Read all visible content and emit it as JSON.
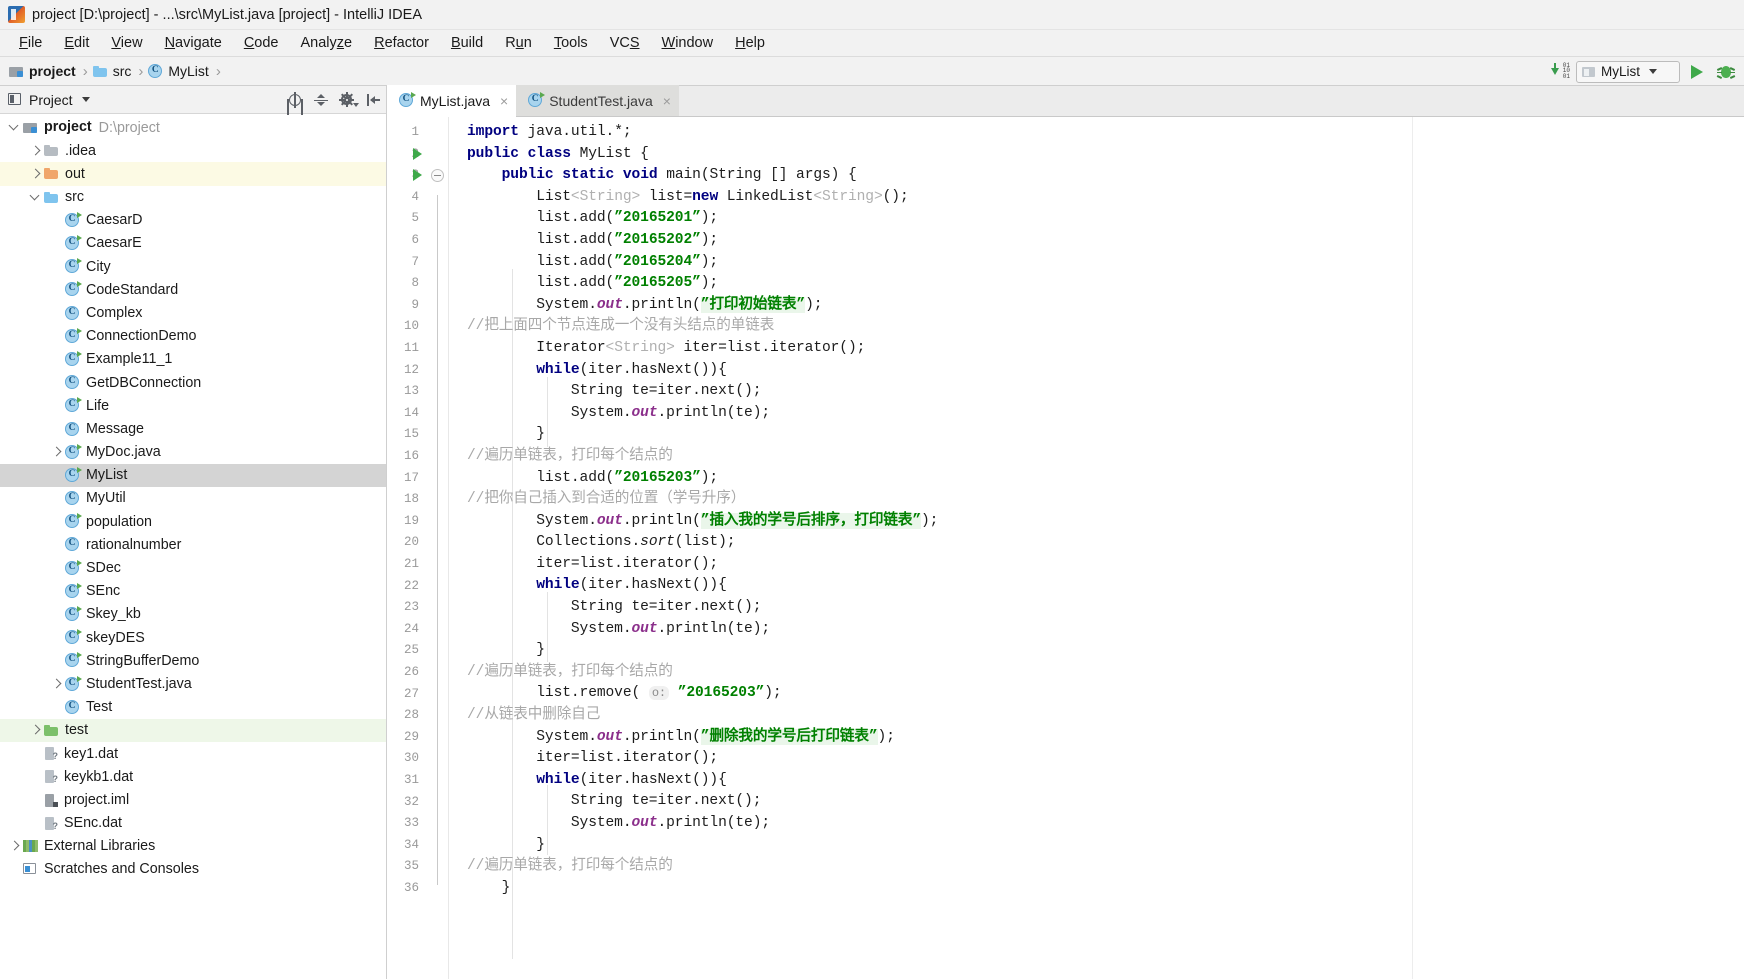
{
  "window": {
    "title": "project [D:\\project] - ...\\src\\MyList.java [project] - IntelliJ IDEA",
    "app_icon": "intellij-idea-icon"
  },
  "menubar": {
    "items": [
      {
        "label": "File"
      },
      {
        "label": "Edit"
      },
      {
        "label": "View"
      },
      {
        "label": "Navigate"
      },
      {
        "label": "Code"
      },
      {
        "label": "Analyze"
      },
      {
        "label": "Refactor"
      },
      {
        "label": "Build"
      },
      {
        "label": "Run"
      },
      {
        "label": "Tools"
      },
      {
        "label": "VCS"
      },
      {
        "label": "Window"
      },
      {
        "label": "Help"
      }
    ]
  },
  "navbar": {
    "crumbs": [
      {
        "label": "project",
        "icon": "module-icon",
        "bold": true
      },
      {
        "label": "src",
        "icon": "folder-icon",
        "bold": false
      },
      {
        "label": "MyList",
        "icon": "java-class-icon",
        "bold": false
      }
    ],
    "separator": "›",
    "updates_icon": "download-updates-icon",
    "run_config": {
      "name": "MyList",
      "icon": "run-config-icon"
    },
    "run_button": "run-icon",
    "debug_button": "debug-icon"
  },
  "panel": {
    "title": "Project",
    "icon": "project-view-icon",
    "tools": [
      {
        "name": "locate-icon"
      },
      {
        "name": "collapse-all-icon"
      },
      {
        "name": "settings-gear-icon"
      },
      {
        "name": "hide-panel-icon"
      }
    ],
    "tree": [
      {
        "label": "project",
        "sub": "D:\\project",
        "icon": "module-icon",
        "indent": 0,
        "arrow": "open",
        "bold": true,
        "hl": ""
      },
      {
        "label": ".idea",
        "sub": "",
        "icon": "folder-gray-icon",
        "indent": 1,
        "arrow": "closed",
        "bold": false,
        "hl": ""
      },
      {
        "label": "out",
        "sub": "",
        "icon": "folder-orange-icon",
        "indent": 1,
        "arrow": "closed",
        "bold": false,
        "hl": "yellow"
      },
      {
        "label": "src",
        "sub": "",
        "icon": "folder-blue-icon",
        "indent": 1,
        "arrow": "open",
        "bold": false,
        "hl": ""
      },
      {
        "label": "CaesarD",
        "sub": "",
        "icon": "java-class-runnable-icon",
        "indent": 2,
        "arrow": "none",
        "bold": false,
        "hl": ""
      },
      {
        "label": "CaesarE",
        "sub": "",
        "icon": "java-class-runnable-icon",
        "indent": 2,
        "arrow": "none",
        "bold": false,
        "hl": ""
      },
      {
        "label": "City",
        "sub": "",
        "icon": "java-class-runnable-icon",
        "indent": 2,
        "arrow": "none",
        "bold": false,
        "hl": ""
      },
      {
        "label": "CodeStandard",
        "sub": "",
        "icon": "java-class-runnable-icon",
        "indent": 2,
        "arrow": "none",
        "bold": false,
        "hl": ""
      },
      {
        "label": "Complex",
        "sub": "",
        "icon": "java-class-icon",
        "indent": 2,
        "arrow": "none",
        "bold": false,
        "hl": ""
      },
      {
        "label": "ConnectionDemo",
        "sub": "",
        "icon": "java-class-runnable-icon",
        "indent": 2,
        "arrow": "none",
        "bold": false,
        "hl": ""
      },
      {
        "label": "Example11_1",
        "sub": "",
        "icon": "java-class-runnable-icon",
        "indent": 2,
        "arrow": "none",
        "bold": false,
        "hl": ""
      },
      {
        "label": "GetDBConnection",
        "sub": "",
        "icon": "java-class-icon",
        "indent": 2,
        "arrow": "none",
        "bold": false,
        "hl": ""
      },
      {
        "label": "Life",
        "sub": "",
        "icon": "java-class-runnable-icon",
        "indent": 2,
        "arrow": "none",
        "bold": false,
        "hl": ""
      },
      {
        "label": "Message",
        "sub": "",
        "icon": "java-class-icon",
        "indent": 2,
        "arrow": "none",
        "bold": false,
        "hl": ""
      },
      {
        "label": "MyDoc.java",
        "sub": "",
        "icon": "java-class-runnable-icon",
        "indent": 2,
        "arrow": "closed",
        "bold": false,
        "hl": ""
      },
      {
        "label": "MyList",
        "sub": "",
        "icon": "java-class-runnable-icon",
        "indent": 2,
        "arrow": "none",
        "bold": false,
        "hl": "selected"
      },
      {
        "label": "MyUtil",
        "sub": "",
        "icon": "java-class-icon",
        "indent": 2,
        "arrow": "none",
        "bold": false,
        "hl": ""
      },
      {
        "label": "population",
        "sub": "",
        "icon": "java-class-runnable-icon",
        "indent": 2,
        "arrow": "none",
        "bold": false,
        "hl": ""
      },
      {
        "label": "rationalnumber",
        "sub": "",
        "icon": "java-class-icon",
        "indent": 2,
        "arrow": "none",
        "bold": false,
        "hl": ""
      },
      {
        "label": "SDec",
        "sub": "",
        "icon": "java-class-runnable-icon",
        "indent": 2,
        "arrow": "none",
        "bold": false,
        "hl": ""
      },
      {
        "label": "SEnc",
        "sub": "",
        "icon": "java-class-runnable-icon",
        "indent": 2,
        "arrow": "none",
        "bold": false,
        "hl": ""
      },
      {
        "label": "Skey_kb",
        "sub": "",
        "icon": "java-class-runnable-icon",
        "indent": 2,
        "arrow": "none",
        "bold": false,
        "hl": ""
      },
      {
        "label": "skeyDES",
        "sub": "",
        "icon": "java-class-runnable-icon",
        "indent": 2,
        "arrow": "none",
        "bold": false,
        "hl": ""
      },
      {
        "label": "StringBufferDemo",
        "sub": "",
        "icon": "java-class-runnable-icon",
        "indent": 2,
        "arrow": "none",
        "bold": false,
        "hl": ""
      },
      {
        "label": "StudentTest.java",
        "sub": "",
        "icon": "java-class-runnable-icon",
        "indent": 2,
        "arrow": "closed",
        "bold": false,
        "hl": ""
      },
      {
        "label": "Test",
        "sub": "",
        "icon": "java-class-icon",
        "indent": 2,
        "arrow": "none",
        "bold": false,
        "hl": ""
      },
      {
        "label": "test",
        "sub": "",
        "icon": "folder-green-icon",
        "indent": 1,
        "arrow": "closed",
        "bold": false,
        "hl": "green"
      },
      {
        "label": "key1.dat",
        "sub": "",
        "icon": "dat-file-icon",
        "indent": 1,
        "arrow": "none",
        "bold": false,
        "hl": ""
      },
      {
        "label": "keykb1.dat",
        "sub": "",
        "icon": "dat-file-icon",
        "indent": 1,
        "arrow": "none",
        "bold": false,
        "hl": ""
      },
      {
        "label": "project.iml",
        "sub": "",
        "icon": "iml-file-icon",
        "indent": 1,
        "arrow": "none",
        "bold": false,
        "hl": ""
      },
      {
        "label": "SEnc.dat",
        "sub": "",
        "icon": "dat-file-icon",
        "indent": 1,
        "arrow": "none",
        "bold": false,
        "hl": ""
      },
      {
        "label": "External Libraries",
        "sub": "",
        "icon": "external-libraries-icon",
        "indent": 0,
        "arrow": "closed",
        "bold": false,
        "hl": ""
      },
      {
        "label": "Scratches and Consoles",
        "sub": "",
        "icon": "scratches-icon",
        "indent": 0,
        "arrow": "none",
        "bold": false,
        "hl": ""
      }
    ]
  },
  "editor": {
    "tabs": [
      {
        "label": "MyList.java",
        "icon": "java-class-runnable-icon",
        "active": true,
        "close": "×"
      },
      {
        "label": "StudentTest.java",
        "icon": "java-class-runnable-icon",
        "active": false,
        "close": "×"
      }
    ],
    "file_name": "MyList.java",
    "lines": [
      {
        "n": "1",
        "gutter": "",
        "fold": false
      },
      {
        "n": "2",
        "gutter": "run",
        "fold": false
      },
      {
        "n": "3",
        "gutter": "run",
        "fold": true
      },
      {
        "n": "4",
        "gutter": "",
        "fold": false
      },
      {
        "n": "5",
        "gutter": "",
        "fold": false
      },
      {
        "n": "6",
        "gutter": "",
        "fold": false
      },
      {
        "n": "7",
        "gutter": "",
        "fold": false
      },
      {
        "n": "8",
        "gutter": "",
        "fold": false
      },
      {
        "n": "9",
        "gutter": "",
        "fold": false
      },
      {
        "n": "10",
        "gutter": "",
        "fold": false
      },
      {
        "n": "11",
        "gutter": "",
        "fold": false
      },
      {
        "n": "12",
        "gutter": "",
        "fold": false
      },
      {
        "n": "13",
        "gutter": "",
        "fold": false
      },
      {
        "n": "14",
        "gutter": "",
        "fold": false
      },
      {
        "n": "15",
        "gutter": "",
        "fold": false
      },
      {
        "n": "16",
        "gutter": "",
        "fold": false
      },
      {
        "n": "17",
        "gutter": "",
        "fold": false
      },
      {
        "n": "18",
        "gutter": "",
        "fold": false
      },
      {
        "n": "19",
        "gutter": "",
        "fold": false
      },
      {
        "n": "20",
        "gutter": "",
        "fold": false
      },
      {
        "n": "21",
        "gutter": "",
        "fold": false
      },
      {
        "n": "22",
        "gutter": "",
        "fold": false
      },
      {
        "n": "23",
        "gutter": "",
        "fold": false
      },
      {
        "n": "24",
        "gutter": "",
        "fold": false
      },
      {
        "n": "25",
        "gutter": "",
        "fold": false
      },
      {
        "n": "26",
        "gutter": "",
        "fold": false
      },
      {
        "n": "27",
        "gutter": "",
        "fold": false
      },
      {
        "n": "28",
        "gutter": "",
        "fold": false
      },
      {
        "n": "29",
        "gutter": "",
        "fold": false
      },
      {
        "n": "30",
        "gutter": "",
        "fold": false
      },
      {
        "n": "31",
        "gutter": "",
        "fold": false
      },
      {
        "n": "32",
        "gutter": "",
        "fold": false
      },
      {
        "n": "33",
        "gutter": "",
        "fold": false
      },
      {
        "n": "34",
        "gutter": "",
        "fold": false
      },
      {
        "n": "35",
        "gutter": "",
        "fold": false
      },
      {
        "n": "36",
        "gutter": "",
        "fold": false
      }
    ],
    "source_text": [
      "import java.util.*;",
      "public class MyList {",
      "    public static void main(String [] args) {",
      "        List<String> list=new LinkedList<String>();",
      "        list.add(\"20165201\");",
      "        list.add(\"20165202\");",
      "        list.add(\"20165204\");",
      "        list.add(\"20165205\");",
      "        System.out.println(\"打印初始链表\");",
      "        //把上面四个节点连成一个没有头结点的单链表",
      "        Iterator<String> iter=list.iterator();",
      "        while(iter.hasNext()){",
      "            String te=iter.next();",
      "            System.out.println(te);",
      "        }",
      "        //遍历单链表，打印每个结点的",
      "        list.add(\"20165203\");",
      "        //把你自己插入到合适的位置（学号升序）",
      "        System.out.println(\"插入我的学号后排序，打印链表\");",
      "        Collections.sort(list);",
      "        iter=list.iterator();",
      "        while(iter.hasNext()){",
      "            String te=iter.next();",
      "            System.out.println(te);",
      "        }",
      "        //遍历单链表，打印每个结点的",
      "        list.remove( o: \"20165203\");",
      "        //从链表中删除自己",
      "        System.out.println(\"删除我的学号后打印链表\");",
      "        iter=list.iterator();",
      "        while(iter.hasNext()){",
      "            String te=iter.next();",
      "            System.out.println(te);",
      "        }",
      "        //遍历单链表，打印每个结点的",
      "    }"
    ],
    "parameter_hint": "o:"
  },
  "colors": {
    "keyword": "#000080",
    "string": "#008000",
    "comment": "#a8a8a8",
    "static_field": "#8b2f8b",
    "selection": "#d4d4d4",
    "accent_green": "#3fa94a",
    "panel_bg": "#f2f2f2"
  }
}
